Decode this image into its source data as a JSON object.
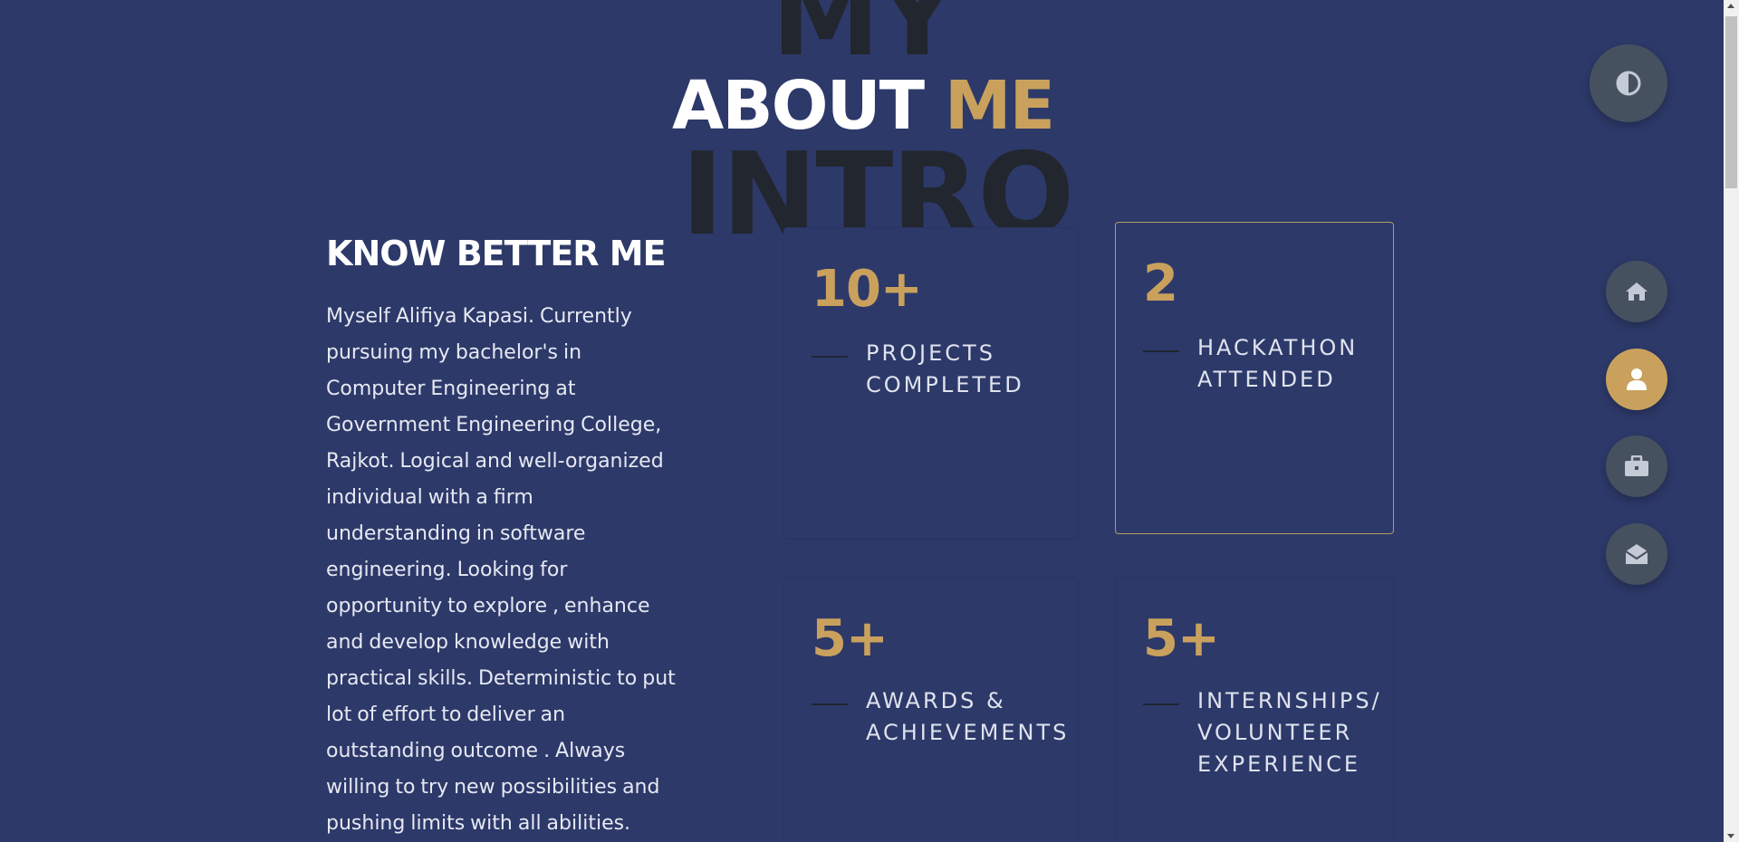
{
  "background_words": {
    "top": "MY",
    "bottom": "INTRO"
  },
  "title": {
    "main": "ABOUT",
    "accent": "ME"
  },
  "about": {
    "heading": "KNOW BETTER ME",
    "paragraph": "Myself Alifiya Kapasi. Currently pursuing my bachelor's in Computer Engineering at Government Engineering College, Rajkot. Logical and well-organized individual with a firm understanding in software engineering. Looking for opportunity to explore , enhance and develop knowledge with practical skills. Deterministic to put lot of effort to deliver an outstanding outcome . Always willing to try new possibilities and pushing limits with all abilities."
  },
  "stats": [
    {
      "value": "10+",
      "label": "PROJECTS COMPLETED"
    },
    {
      "value": "2",
      "label": "HACKATHON ATTENDED"
    },
    {
      "value": "5+",
      "label": "AWARDS & ACHIEVEMENTS"
    },
    {
      "value": "5+",
      "label": "INTERNSHIPS/ VOLUNTEER EXPERIENCE"
    }
  ],
  "nav": {
    "theme_toggle_icon": "half-circle-icon",
    "items": [
      {
        "icon": "home-icon",
        "active": false
      },
      {
        "icon": "user-icon",
        "active": true
      },
      {
        "icon": "briefcase-icon",
        "active": false
      },
      {
        "icon": "envelope-open-icon",
        "active": false
      }
    ]
  },
  "colors": {
    "background": "#2d3969",
    "accent": "#c9a15d",
    "text": "#ffffff",
    "fab": "#465160",
    "bg_word": "#22262e"
  }
}
